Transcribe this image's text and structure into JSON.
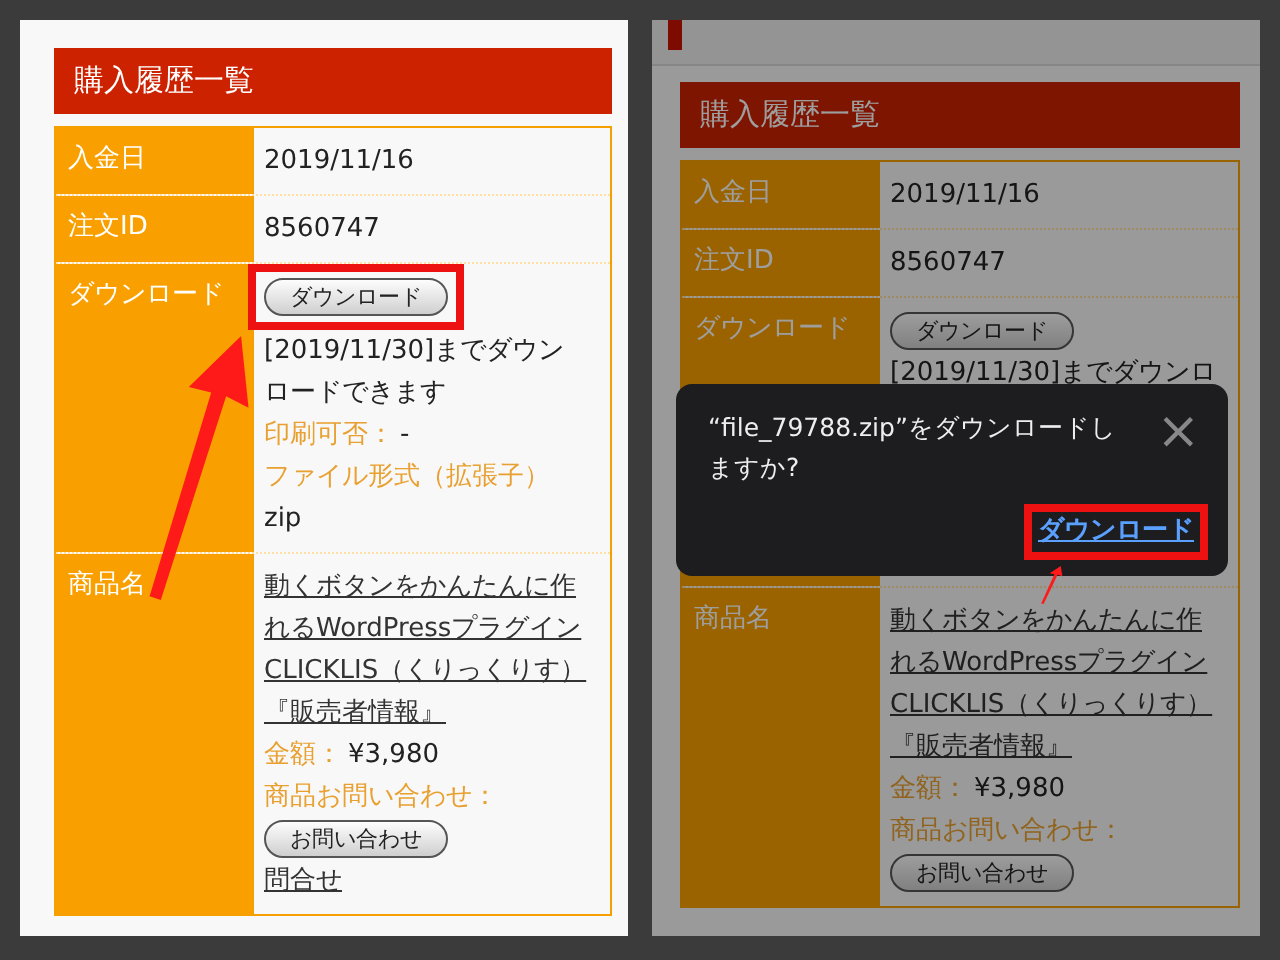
{
  "panels": [
    {
      "dimmed": false,
      "top_strip": false,
      "section_title": "購入履歴一覧",
      "rows": [
        {
          "label": "入金日",
          "kind": "text",
          "value": "2019/11/16"
        },
        {
          "label": "注文ID",
          "kind": "text",
          "value": "8560747"
        },
        {
          "label": "ダウンロード",
          "kind": "items",
          "items": [
            {
              "kind": "button",
              "text": "ダウンロード",
              "highlighted": true
            },
            {
              "kind": "text",
              "text": "[2019/11/30]までダウンロードできます"
            },
            {
              "kind": "field",
              "label": "印刷可否：",
              "value": "-"
            },
            {
              "kind": "heading",
              "text": "ファイル形式（拡張子）"
            },
            {
              "kind": "text",
              "text": "zip"
            }
          ]
        },
        {
          "label": "商品名",
          "kind": "items",
          "items": [
            {
              "kind": "link",
              "text": "動くボタンをかんたんに作れるWordPressプラグインCLICKLIS（くりっくりす）"
            },
            {
              "kind": "link",
              "text": "『販売者情報』"
            },
            {
              "kind": "field",
              "label": "金額：",
              "value": "¥3,980"
            },
            {
              "kind": "field",
              "label": "商品お問い合わせ："
            },
            {
              "kind": "button",
              "text": "お問い合わせ",
              "highlighted": false
            },
            {
              "kind": "link",
              "text": "問合せ"
            }
          ]
        }
      ]
    },
    {
      "dimmed": true,
      "top_strip": true,
      "section_title": "購入履歴一覧",
      "rows": [
        {
          "label": "入金日",
          "kind": "text",
          "value": "2019/11/16"
        },
        {
          "label": "注文ID",
          "kind": "text",
          "value": "8560747"
        },
        {
          "label": "ダウンロード",
          "kind": "items",
          "covered": true,
          "items": [
            {
              "kind": "button",
              "text": "ダウンロード",
              "highlighted": false
            },
            {
              "kind": "text",
              "text": "[2019/11/30]までダウンロ"
            }
          ]
        },
        {
          "label": "商品名",
          "kind": "items",
          "items": [
            {
              "kind": "link",
              "text": "動くボタンをかんたんに作れるWordPressプラグインCLICKLIS（くりっくりす）"
            },
            {
              "kind": "link",
              "text": "『販売者情報』"
            },
            {
              "kind": "field",
              "label": "金額：",
              "value": "¥3,980"
            },
            {
              "kind": "field",
              "label": "商品お問い合わせ："
            },
            {
              "kind": "button",
              "text": "お問い合わせ",
              "highlighted": false
            }
          ]
        }
      ],
      "dialog": {
        "message": "“file_79788.zip”をダウンロードしますか?",
        "close": "×",
        "action": "ダウンロード",
        "action_highlighted": true
      }
    }
  ]
}
